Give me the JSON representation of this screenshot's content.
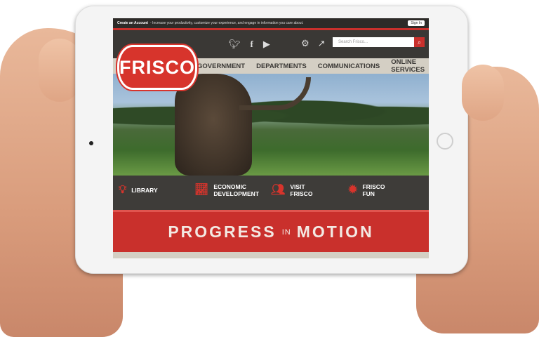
{
  "topbar": {
    "create_account": "Create an Account",
    "tagline": "- Increase your productivity, customize your experience, and engage in information you care about.",
    "sign_in": "Sign In"
  },
  "search": {
    "placeholder": "Search Frisco..."
  },
  "logo": {
    "text": "FRISCO"
  },
  "nav": {
    "items": [
      "GOVERNMENT",
      "DEPARTMENTS",
      "COMMUNICATIONS",
      "ONLINE SERVICES"
    ]
  },
  "quick_links": {
    "library": "LIBRARY",
    "economic_1": "ECONOMIC",
    "economic_2": "DEVELOPMENT",
    "visit_1": "VISIT",
    "visit_2": "FRISCO",
    "fun_1": "FRISCO",
    "fun_2": "FUN"
  },
  "banner": {
    "word1": "PROGRESS",
    "word2": "IN",
    "word3": "MOTION"
  },
  "colors": {
    "accent": "#c9302c",
    "nav_bg": "#d4cfc4",
    "header_bg": "#3a3835"
  }
}
